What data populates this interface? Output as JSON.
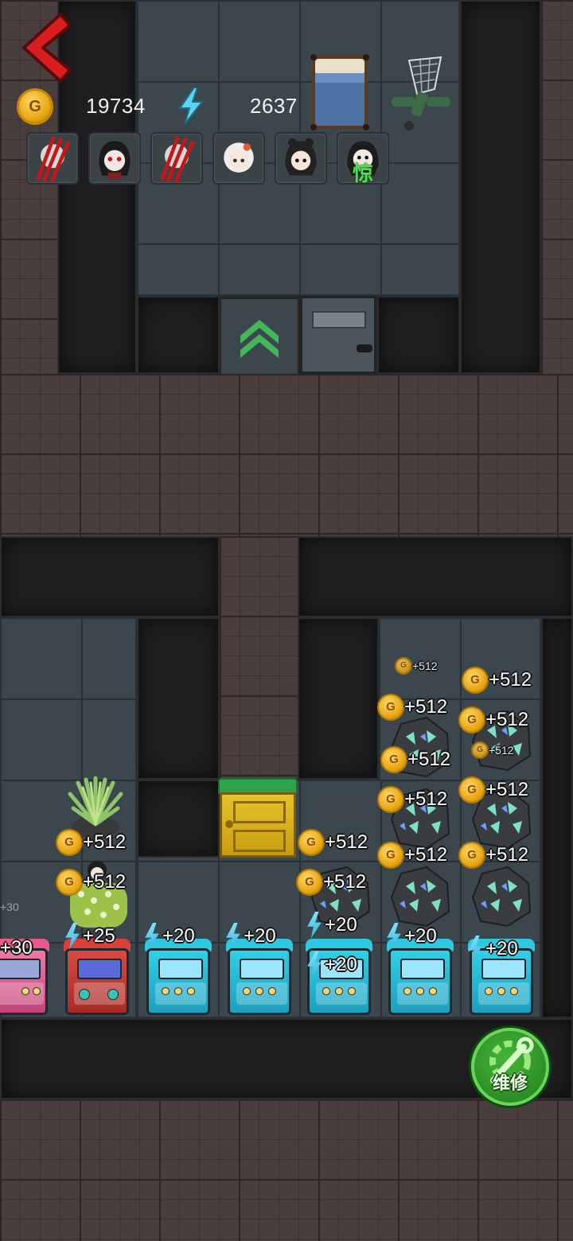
{
  "hud": {
    "gold": "19734",
    "energy": "2637",
    "coin_letter": "G",
    "avatars": [
      {
        "name": "claw-marks-portrait"
      },
      {
        "name": "ghost-girl-portrait"
      },
      {
        "name": "claw-marks-portrait"
      },
      {
        "name": "white-hair-girl-portrait"
      },
      {
        "name": "dark-hair-girl-portrait"
      },
      {
        "name": "green-marked-girl-portrait",
        "badge": "惊"
      }
    ]
  },
  "room_labels": {
    "faint_512": "+512",
    "faint_30": "+30",
    "gold_512": "+512",
    "energy_30": "+30",
    "energy_25": "+25",
    "energy_20": "+20"
  },
  "repair_button": {
    "label": "维修"
  },
  "colors": {
    "brick": "#4a3d3d",
    "tile": "#3b474d",
    "wall": "#1f1f21",
    "gold": "#e6a310",
    "energy": "#2aa9d6",
    "repair_green": "#2f9a28"
  }
}
